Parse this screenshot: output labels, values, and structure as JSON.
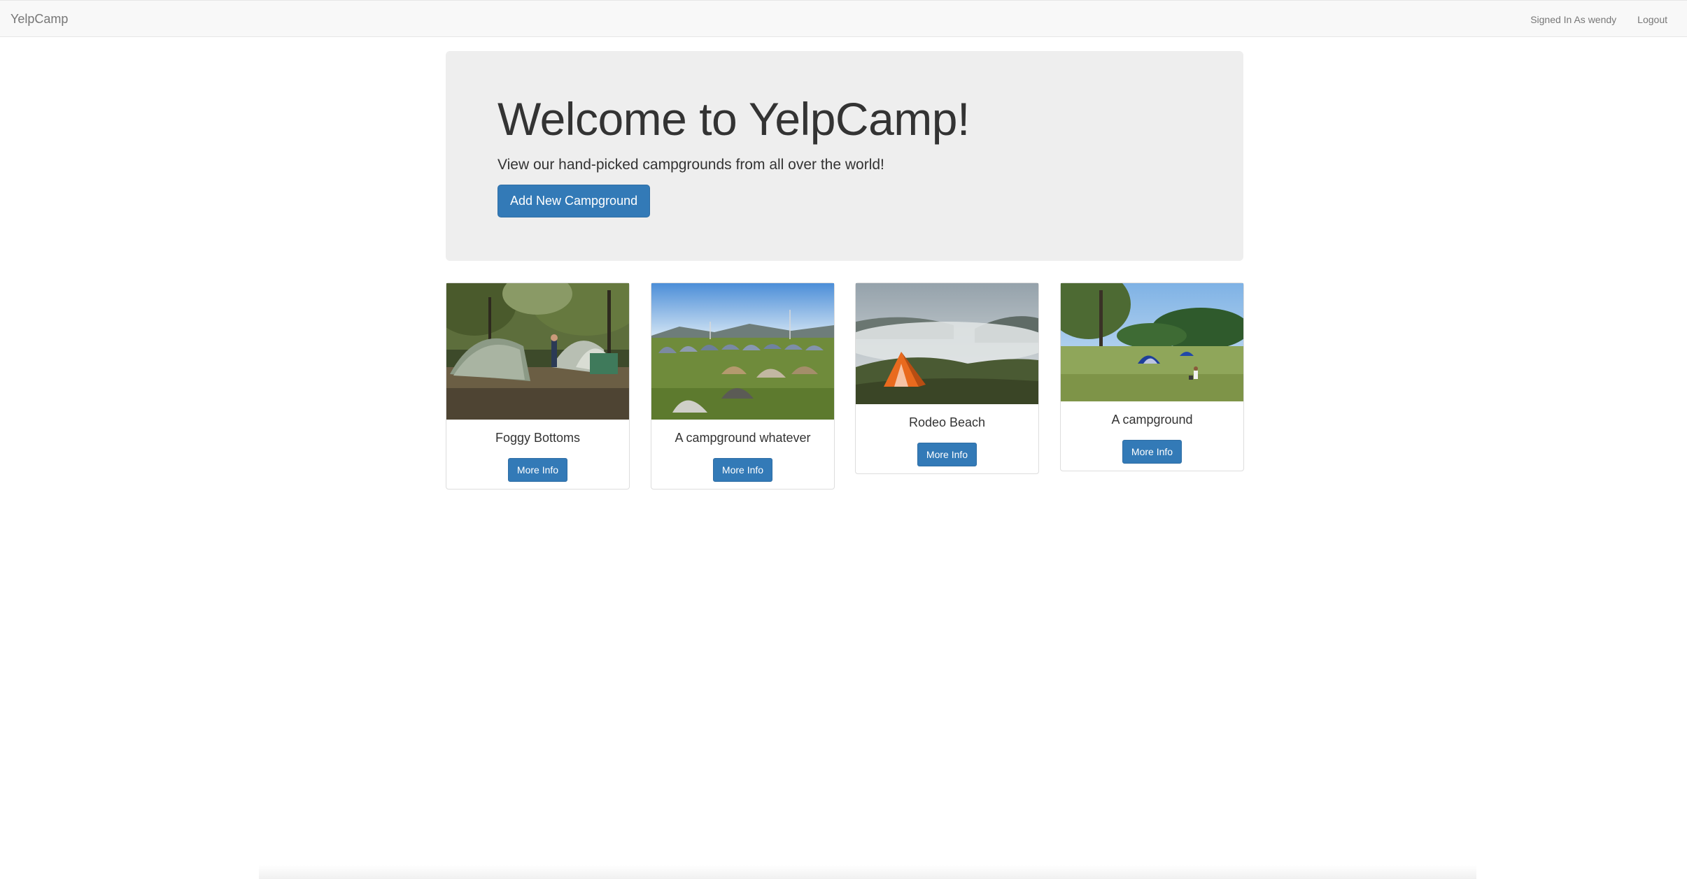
{
  "navbar": {
    "brand": "YelpCamp",
    "signed_in_text": "Signed In As wendy",
    "logout_label": "Logout"
  },
  "jumbotron": {
    "title": "Welcome to YelpCamp!",
    "subtitle": "View our hand-picked campgrounds from all over the world!",
    "add_button_label": "Add New Campground"
  },
  "campgrounds": [
    {
      "name": "Foggy Bottoms",
      "button_label": "More Info",
      "image": "tents-in-forest"
    },
    {
      "name": "A campground whatever",
      "button_label": "More Info",
      "image": "many-tents-on-field"
    },
    {
      "name": "Rodeo Beach",
      "button_label": "More Info",
      "image": "orange-tent-misty-valley"
    },
    {
      "name": "A campground",
      "button_label": "More Info",
      "image": "tents-in-park"
    }
  ],
  "colors": {
    "primary": "#337ab7",
    "navbar_bg": "#f8f8f8",
    "jumbotron_bg": "#eeeeee"
  }
}
